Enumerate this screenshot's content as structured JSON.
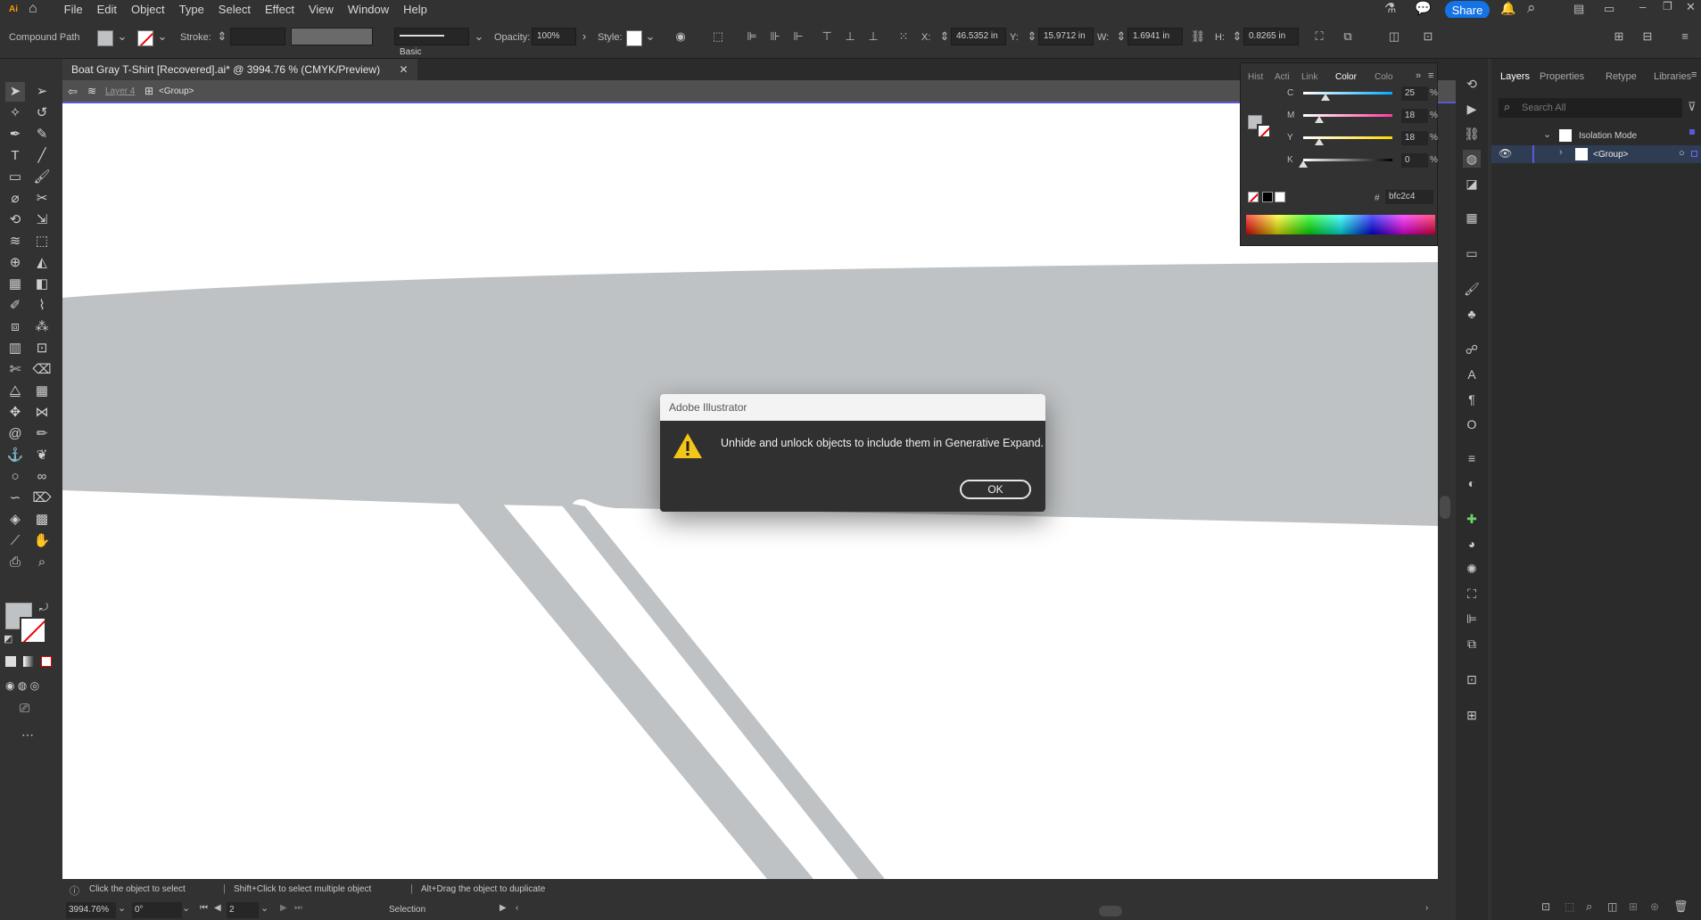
{
  "app": {
    "logo": "Ai",
    "brand_color": "#ff9a00"
  },
  "menu": [
    "File",
    "Edit",
    "Object",
    "Type",
    "Select",
    "Effect",
    "View",
    "Window",
    "Help"
  ],
  "topbar": {
    "share_label": "Share",
    "share_color": "#1473e6"
  },
  "control_bar": {
    "selection_type": "Compound Path",
    "stroke_label": "Stroke:",
    "brush_label": "Basic",
    "opacity_label": "Opacity:",
    "opacity_value": "100%",
    "style_label": "Style:",
    "x_label": "X:",
    "x_value": "46.5352 in",
    "y_label": "Y:",
    "y_value": "15.9712 in",
    "w_label": "W:",
    "w_value": "1.6941 in",
    "h_label": "H:",
    "h_value": "0.8265 in"
  },
  "document": {
    "tab_title": "Boat Gray T-Shirt [Recovered].ai* @ 3994.76 % (CMYK/Preview)",
    "breadcrumb_layer": "Layer 4",
    "breadcrumb_group": "<Group>",
    "fill_color": "#bfc2c4"
  },
  "color_panel": {
    "tabs": [
      "Hist",
      "Acti",
      "Link",
      "Color",
      "Colo"
    ],
    "channels": [
      {
        "name": "C",
        "value": "25",
        "pct": 0.25,
        "gradient": "#00aaff"
      },
      {
        "name": "M",
        "value": "18",
        "pct": 0.18,
        "gradient": "#ff3aa0"
      },
      {
        "name": "Y",
        "value": "18",
        "pct": 0.18,
        "gradient": "#ffd800"
      },
      {
        "name": "K",
        "value": "0",
        "pct": 0.0,
        "gradient": "#000000"
      }
    ],
    "unit": "%",
    "hex_symbol": "#",
    "hex_value": "bfc2c4"
  },
  "layers_panel": {
    "tabs": [
      "Layers",
      "Properties",
      "Retype",
      "Libraries"
    ],
    "search_placeholder": "Search All",
    "isolation_label": "Isolation Mode",
    "group_label": "<Group>"
  },
  "dialog": {
    "title": "Adobe Illustrator",
    "message": "Unhide and unlock objects to include them in Generative Expand.",
    "ok_label": "OK"
  },
  "status": {
    "hint1": "Click the object to select",
    "hint2": "Shift+Click to select multiple object",
    "hint3": "Alt+Drag the object to duplicate",
    "zoom": "3994.76%",
    "rotation": "0°",
    "artboard": "2",
    "tool": "Selection"
  }
}
